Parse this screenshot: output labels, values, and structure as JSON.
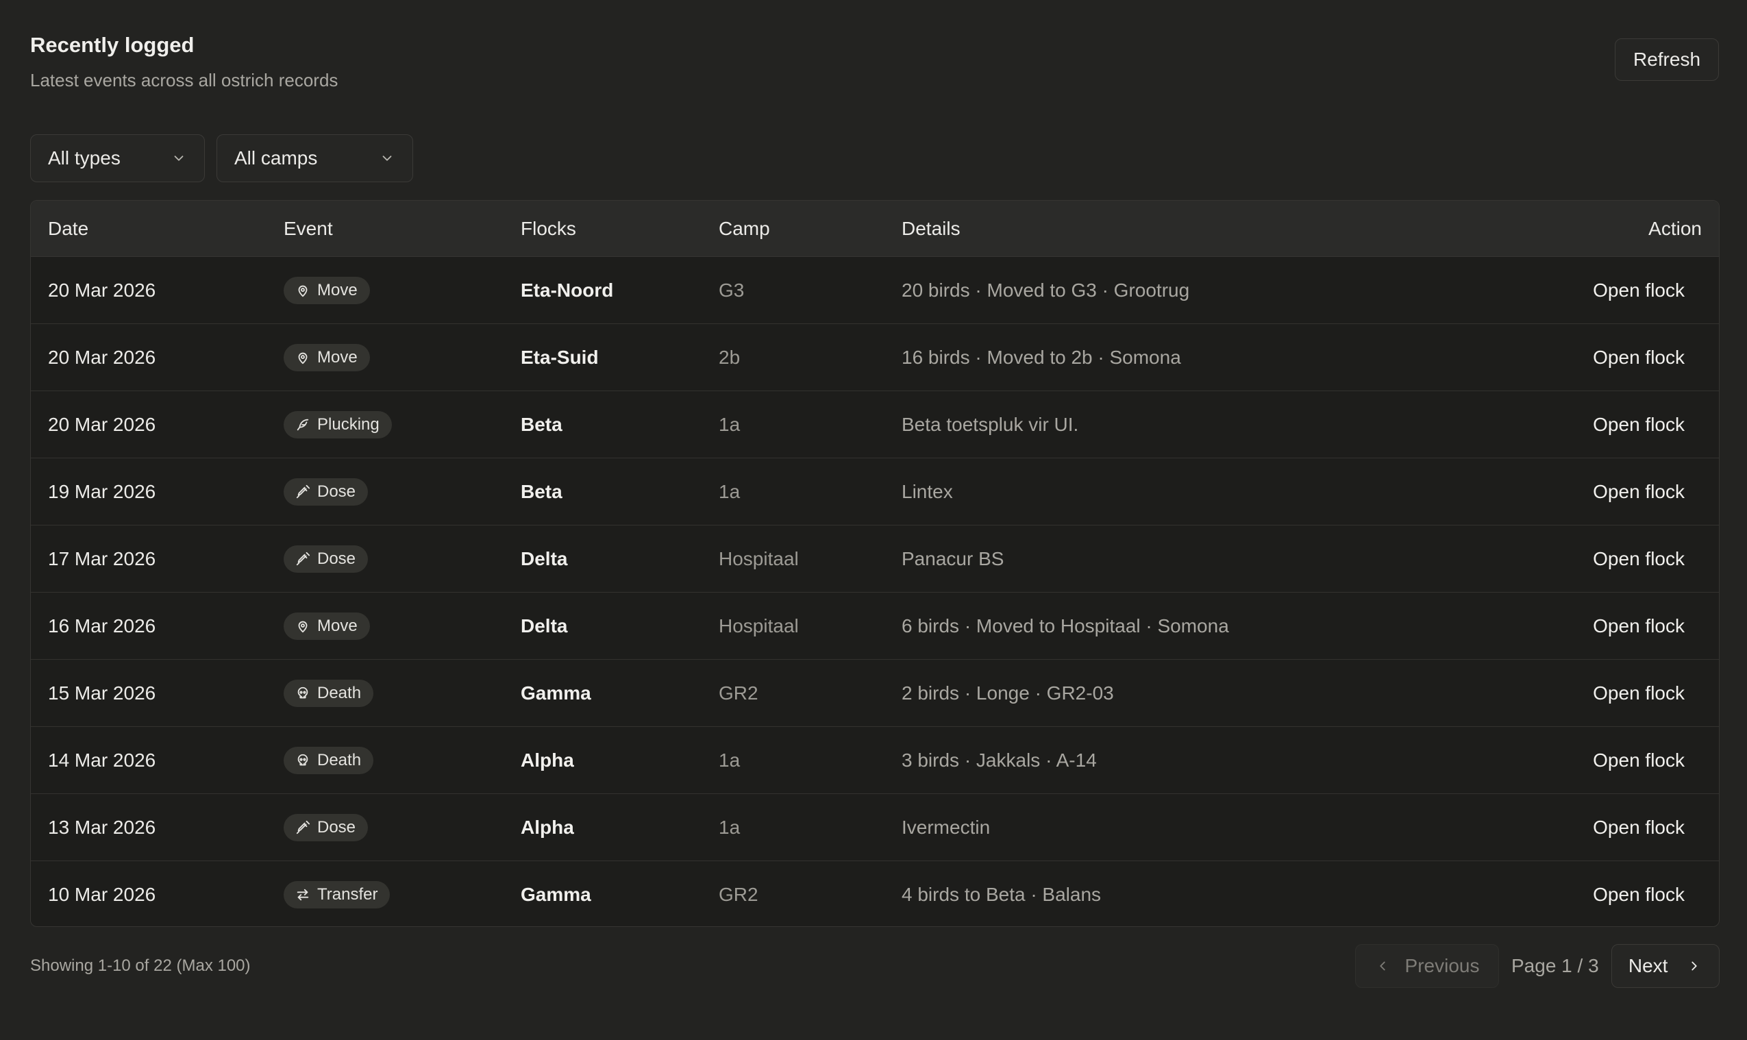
{
  "header": {
    "title": "Recently logged",
    "subtitle": "Latest events across all ostrich records",
    "refresh_label": "Refresh"
  },
  "filters": {
    "types": "All types",
    "camps": "All camps"
  },
  "table": {
    "columns": [
      "Date",
      "Event",
      "Flocks",
      "Camp",
      "Details",
      "Action"
    ],
    "rows": [
      {
        "date": "20 Mar 2026",
        "event": "Move",
        "icon": "map-pin-icon",
        "flock": "Eta-Noord",
        "camp": "G3",
        "details": "20 birds · Moved to G3 · Grootrug",
        "action": "Open flock"
      },
      {
        "date": "20 Mar 2026",
        "event": "Move",
        "icon": "map-pin-icon",
        "flock": "Eta-Suid",
        "camp": "2b",
        "details": "16 birds · Moved to 2b · Somona",
        "action": "Open flock"
      },
      {
        "date": "20 Mar 2026",
        "event": "Plucking",
        "icon": "feather-icon",
        "flock": "Beta",
        "camp": "1a",
        "details": "Beta toetspluk vir UI.",
        "action": "Open flock"
      },
      {
        "date": "19 Mar 2026",
        "event": "Dose",
        "icon": "syringe-icon",
        "flock": "Beta",
        "camp": "1a",
        "details": "Lintex",
        "action": "Open flock"
      },
      {
        "date": "17 Mar 2026",
        "event": "Dose",
        "icon": "syringe-icon",
        "flock": "Delta",
        "camp": "Hospitaal",
        "details": "Panacur BS",
        "action": "Open flock"
      },
      {
        "date": "16 Mar 2026",
        "event": "Move",
        "icon": "map-pin-icon",
        "flock": "Delta",
        "camp": "Hospitaal",
        "details": "6 birds · Moved to Hospitaal · Somona",
        "action": "Open flock"
      },
      {
        "date": "15 Mar 2026",
        "event": "Death",
        "icon": "skull-icon",
        "flock": "Gamma",
        "camp": "GR2",
        "details": "2 birds · Longe · GR2-03",
        "action": "Open flock"
      },
      {
        "date": "14 Mar 2026",
        "event": "Death",
        "icon": "skull-icon",
        "flock": "Alpha",
        "camp": "1a",
        "details": "3 birds · Jakkals · A-14",
        "action": "Open flock"
      },
      {
        "date": "13 Mar 2026",
        "event": "Dose",
        "icon": "syringe-icon",
        "flock": "Alpha",
        "camp": "1a",
        "details": "Ivermectin",
        "action": "Open flock"
      },
      {
        "date": "10 Mar 2026",
        "event": "Transfer",
        "icon": "transfer-arrows-icon",
        "flock": "Gamma",
        "camp": "GR2",
        "details": "4 birds to Beta · Balans",
        "action": "Open flock"
      }
    ]
  },
  "footer": {
    "showing": "Showing 1-10 of 22 (Max 100)",
    "previous_label": "Previous",
    "page_label": "Page 1 / 3",
    "next_label": "Next"
  }
}
